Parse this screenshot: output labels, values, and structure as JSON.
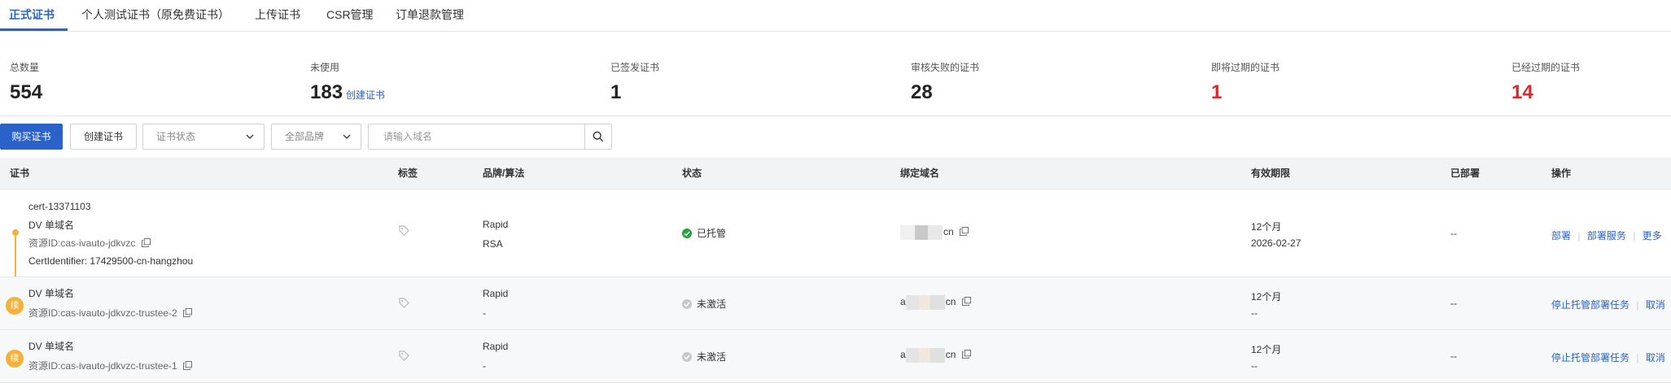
{
  "tabs": [
    "正式证书",
    "个人测试证书（原免费证书）",
    "上传证书",
    "CSR管理",
    "订单退款管理"
  ],
  "stats": {
    "total": {
      "label": "总数量",
      "value": "554"
    },
    "unused": {
      "label": "未使用",
      "value": "183",
      "link": "创建证书"
    },
    "issued": {
      "label": "已签发证书",
      "value": "1"
    },
    "failed": {
      "label": "审核失败的证书",
      "value": "28"
    },
    "expiring": {
      "label": "即将过期的证书",
      "value": "1"
    },
    "expired": {
      "label": "已经过期的证书",
      "value": "14"
    }
  },
  "toolbar": {
    "buy_label": "购买证书",
    "create_label": "创建证书",
    "status_select": "证书状态",
    "brand_select": "全部品牌",
    "search_placeholder": "请输入域名"
  },
  "table": {
    "columns": [
      "证书",
      "标签",
      "品牌/算法",
      "状态",
      "绑定域名",
      "有效期限",
      "已部署",
      "操作"
    ],
    "rows": [
      {
        "cert_name": "cert-13371103",
        "type": "DV 单域名",
        "resource_id": "资源ID:cas-ivauto-jdkvzc",
        "identifier": "CertIdentifier: 17429500-cn-hangzhou",
        "brand": "Rapid",
        "algorithm": "RSA",
        "status": "已托管",
        "domain_suffix": "cn",
        "validity": "12个月",
        "expiry": "2026-02-27",
        "deployed": "--",
        "actions": [
          "部署",
          "部署服务",
          "更多"
        ]
      },
      {
        "badge": "续",
        "type": "DV 单域名",
        "resource_id": "资源ID:cas-ivauto-jdkvzc-trustee-2",
        "brand": "Rapid",
        "algorithm": "-",
        "status": "未激活",
        "domain_prefix": "a",
        "domain_suffix": "cn",
        "validity": "12个月",
        "expiry": "--",
        "deployed": "--",
        "actions": [
          "停止托管部署任务",
          "取消"
        ]
      },
      {
        "badge": "续",
        "type": "DV 单域名",
        "resource_id": "资源ID:cas-ivauto-jdkvzc-trustee-1",
        "brand": "Rapid",
        "algorithm": "-",
        "status": "未激活",
        "domain_prefix": "a",
        "domain_suffix": "cn",
        "validity": "12个月",
        "expiry": "--",
        "deployed": "--",
        "actions": [
          "停止托管部署任务",
          "取消"
        ]
      }
    ]
  },
  "colors": {
    "accent": "#2a62c9",
    "danger": "#d9292f",
    "renew_badge": "#f4b23a",
    "status_ok": "#26a33a"
  }
}
